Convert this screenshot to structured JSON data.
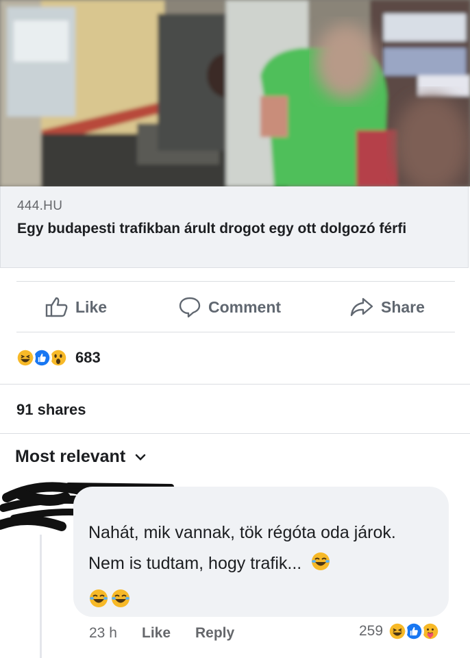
{
  "post": {
    "link_preview": {
      "domain": "444.HU",
      "title": "Egy budapesti trafikban árult drogot egy ott dolgozó férfi"
    },
    "actions": {
      "like": "Like",
      "comment": "Comment",
      "share": "Share"
    },
    "reactions": {
      "icons": [
        "haha-emoji",
        "like-emoji",
        "wow-emoji"
      ],
      "count": "683"
    },
    "shares": "91 shares",
    "sort_label": "Most relevant"
  },
  "comment": {
    "text": "Nahát, mik vannak, tök régóta oda járok. Nem is tudtam, hogy trafik...",
    "time": "23 h",
    "like": "Like",
    "reply": "Reply",
    "reaction_count": "259",
    "reaction_icons": [
      "haha-emoji",
      "like-emoji",
      "care-emoji"
    ]
  },
  "colors": {
    "link_box_bg": "#f0f2f5",
    "secondary_text": "#65676b",
    "like_blue": "#1877f2",
    "haha_yellow": "#f7b928"
  }
}
